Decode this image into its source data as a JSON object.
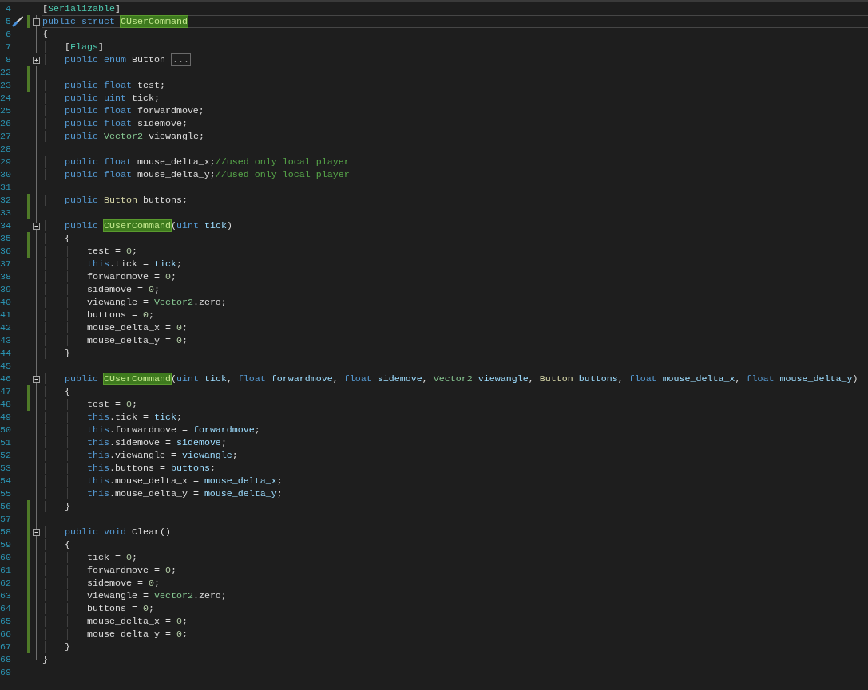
{
  "lines": [
    {
      "number": "4",
      "changed": false,
      "kind": "outer",
      "action": false,
      "current": false,
      "tokens": [
        {
          "kind": "plain",
          "text": "["
        },
        {
          "kind": "type",
          "text": "Serializable"
        },
        {
          "kind": "plain",
          "text": "]"
        }
      ]
    },
    {
      "number": "5",
      "changed": true,
      "kind": "open",
      "action": true,
      "current": true,
      "tokens": [
        {
          "kind": "keyword",
          "text": "public struct "
        },
        {
          "kind": "match",
          "text": "CUserCommand"
        }
      ]
    },
    {
      "number": "6",
      "changed": false,
      "kind": "body",
      "action": false,
      "current": false,
      "tokens": [
        {
          "kind": "plain",
          "text": "{"
        }
      ]
    },
    {
      "number": "7",
      "changed": false,
      "kind": "body",
      "action": false,
      "current": false,
      "tokens": [
        {
          "kind": "plain",
          "text": "    ["
        },
        {
          "kind": "type",
          "text": "Flags"
        },
        {
          "kind": "plain",
          "text": "]"
        }
      ]
    },
    {
      "number": "8",
      "changed": false,
      "kind": "closed",
      "action": false,
      "current": false,
      "tokens": [
        {
          "kind": "keyword",
          "text": "    public enum "
        },
        {
          "kind": "plain",
          "text": "Button "
        },
        {
          "kind": "collapsed",
          "text": "..."
        }
      ]
    },
    {
      "number": "22",
      "changed": true,
      "kind": "body",
      "action": false,
      "current": false
    },
    {
      "number": "23",
      "changed": true,
      "kind": "body",
      "action": false,
      "current": false,
      "tokens": [
        {
          "kind": "keyword",
          "text": "    public float "
        },
        {
          "kind": "plain",
          "text": "test;"
        }
      ]
    },
    {
      "number": "24",
      "changed": false,
      "kind": "body",
      "action": false,
      "current": false,
      "tokens": [
        {
          "kind": "keyword",
          "text": "    public uint "
        },
        {
          "kind": "plain",
          "text": "tick;"
        }
      ]
    },
    {
      "number": "25",
      "changed": false,
      "kind": "body",
      "action": false,
      "current": false,
      "tokens": [
        {
          "kind": "keyword",
          "text": "    public float "
        },
        {
          "kind": "plain",
          "text": "forwardmove;"
        }
      ]
    },
    {
      "number": "26",
      "changed": false,
      "kind": "body",
      "action": false,
      "current": false,
      "tokens": [
        {
          "kind": "keyword",
          "text": "    public float "
        },
        {
          "kind": "plain",
          "text": "sidemove;"
        }
      ]
    },
    {
      "number": "27",
      "changed": false,
      "kind": "body",
      "action": false,
      "current": false,
      "tokens": [
        {
          "kind": "keyword",
          "text": "    public "
        },
        {
          "kind": "struct",
          "text": "Vector2 "
        },
        {
          "kind": "plain",
          "text": "viewangle;"
        }
      ]
    },
    {
      "number": "28",
      "changed": false,
      "kind": "body",
      "action": false,
      "current": false
    },
    {
      "number": "29",
      "changed": false,
      "kind": "body",
      "action": false,
      "current": false,
      "tokens": [
        {
          "kind": "keyword",
          "text": "    public float "
        },
        {
          "kind": "plain",
          "text": "mouse_delta_x;"
        },
        {
          "kind": "comment",
          "text": "//used only local player"
        }
      ]
    },
    {
      "number": "30",
      "changed": false,
      "kind": "body",
      "action": false,
      "current": false,
      "tokens": [
        {
          "kind": "keyword",
          "text": "    public float "
        },
        {
          "kind": "plain",
          "text": "mouse_delta_y;"
        },
        {
          "kind": "comment",
          "text": "//used only local player"
        }
      ]
    },
    {
      "number": "31",
      "changed": false,
      "kind": "body",
      "action": false,
      "current": false
    },
    {
      "number": "32",
      "changed": true,
      "kind": "body",
      "action": false,
      "current": false,
      "tokens": [
        {
          "kind": "keyword",
          "text": "    public "
        },
        {
          "kind": "enum",
          "text": "Button "
        },
        {
          "kind": "plain",
          "text": "buttons;"
        }
      ]
    },
    {
      "number": "33",
      "changed": true,
      "kind": "body",
      "action": false,
      "current": false
    },
    {
      "number": "34",
      "changed": false,
      "kind": "open",
      "action": false,
      "current": false,
      "tokens": [
        {
          "kind": "keyword",
          "text": "    public "
        },
        {
          "kind": "match",
          "text": "CUserCommand"
        },
        {
          "kind": "plain",
          "text": "("
        },
        {
          "kind": "keyword",
          "text": "uint "
        },
        {
          "kind": "param",
          "text": "tick"
        },
        {
          "kind": "plain",
          "text": ")"
        }
      ]
    },
    {
      "number": "35",
      "changed": true,
      "kind": "body",
      "action": false,
      "current": false,
      "tokens": [
        {
          "kind": "plain",
          "text": "    {"
        }
      ]
    },
    {
      "number": "36",
      "changed": true,
      "kind": "body",
      "action": false,
      "current": false,
      "tokens": [
        {
          "kind": "plain",
          "text": "        test = "
        },
        {
          "kind": "number",
          "text": "0"
        },
        {
          "kind": "plain",
          "text": ";"
        }
      ]
    },
    {
      "number": "37",
      "changed": false,
      "kind": "body",
      "action": false,
      "current": false,
      "tokens": [
        {
          "kind": "keyword",
          "text": "        this"
        },
        {
          "kind": "plain",
          "text": ".tick = "
        },
        {
          "kind": "param",
          "text": "tick"
        },
        {
          "kind": "plain",
          "text": ";"
        }
      ]
    },
    {
      "number": "38",
      "changed": false,
      "kind": "body",
      "action": false,
      "current": false,
      "tokens": [
        {
          "kind": "plain",
          "text": "        forwardmove = "
        },
        {
          "kind": "number",
          "text": "0"
        },
        {
          "kind": "plain",
          "text": ";"
        }
      ]
    },
    {
      "number": "39",
      "changed": false,
      "kind": "body",
      "action": false,
      "current": false,
      "tokens": [
        {
          "kind": "plain",
          "text": "        sidemove = "
        },
        {
          "kind": "number",
          "text": "0"
        },
        {
          "kind": "plain",
          "text": ";"
        }
      ]
    },
    {
      "number": "40",
      "changed": false,
      "kind": "body",
      "action": false,
      "current": false,
      "tokens": [
        {
          "kind": "plain",
          "text": "        viewangle = "
        },
        {
          "kind": "struct",
          "text": "Vector2"
        },
        {
          "kind": "plain",
          "text": ".zero;"
        }
      ]
    },
    {
      "number": "41",
      "changed": false,
      "kind": "body",
      "action": false,
      "current": false,
      "tokens": [
        {
          "kind": "plain",
          "text": "        buttons = "
        },
        {
          "kind": "number",
          "text": "0"
        },
        {
          "kind": "plain",
          "text": ";"
        }
      ]
    },
    {
      "number": "42",
      "changed": false,
      "kind": "body",
      "action": false,
      "current": false,
      "tokens": [
        {
          "kind": "plain",
          "text": "        mouse_delta_x = "
        },
        {
          "kind": "number",
          "text": "0"
        },
        {
          "kind": "plain",
          "text": ";"
        }
      ]
    },
    {
      "number": "43",
      "changed": false,
      "kind": "body",
      "action": false,
      "current": false,
      "tokens": [
        {
          "kind": "plain",
          "text": "        mouse_delta_y = "
        },
        {
          "kind": "number",
          "text": "0"
        },
        {
          "kind": "plain",
          "text": ";"
        }
      ]
    },
    {
      "number": "44",
      "changed": false,
      "kind": "body",
      "action": false,
      "current": false,
      "tokens": [
        {
          "kind": "plain",
          "text": "    }"
        }
      ]
    },
    {
      "number": "45",
      "changed": false,
      "kind": "body",
      "action": false,
      "current": false
    },
    {
      "number": "46",
      "changed": false,
      "kind": "open",
      "action": false,
      "current": false,
      "tokens": [
        {
          "kind": "keyword",
          "text": "    public "
        },
        {
          "kind": "match",
          "text": "CUserCommand"
        },
        {
          "kind": "plain",
          "text": "("
        },
        {
          "kind": "keyword",
          "text": "uint "
        },
        {
          "kind": "param",
          "text": "tick"
        },
        {
          "kind": "plain",
          "text": ", "
        },
        {
          "kind": "keyword",
          "text": "float "
        },
        {
          "kind": "param",
          "text": "forwardmove"
        },
        {
          "kind": "plain",
          "text": ", "
        },
        {
          "kind": "keyword",
          "text": "float "
        },
        {
          "kind": "param",
          "text": "sidemove"
        },
        {
          "kind": "plain",
          "text": ", "
        },
        {
          "kind": "struct",
          "text": "Vector2 "
        },
        {
          "kind": "param",
          "text": "viewangle"
        },
        {
          "kind": "plain",
          "text": ", "
        },
        {
          "kind": "enum",
          "text": "Button "
        },
        {
          "kind": "param",
          "text": "buttons"
        },
        {
          "kind": "plain",
          "text": ", "
        },
        {
          "kind": "keyword",
          "text": "float "
        },
        {
          "kind": "param",
          "text": "mouse_delta_x"
        },
        {
          "kind": "plain",
          "text": ", "
        },
        {
          "kind": "keyword",
          "text": "float "
        },
        {
          "kind": "param",
          "text": "mouse_delta_y"
        },
        {
          "kind": "plain",
          "text": ")"
        }
      ]
    },
    {
      "number": "47",
      "changed": true,
      "kind": "body",
      "action": false,
      "current": false,
      "tokens": [
        {
          "kind": "plain",
          "text": "    {"
        }
      ]
    },
    {
      "number": "48",
      "changed": true,
      "kind": "body",
      "action": false,
      "current": false,
      "tokens": [
        {
          "kind": "plain",
          "text": "        test = "
        },
        {
          "kind": "number",
          "text": "0"
        },
        {
          "kind": "plain",
          "text": ";"
        }
      ]
    },
    {
      "number": "49",
      "changed": false,
      "kind": "body",
      "action": false,
      "current": false,
      "tokens": [
        {
          "kind": "keyword",
          "text": "        this"
        },
        {
          "kind": "plain",
          "text": ".tick = "
        },
        {
          "kind": "param",
          "text": "tick"
        },
        {
          "kind": "plain",
          "text": ";"
        }
      ]
    },
    {
      "number": "50",
      "changed": false,
      "kind": "body",
      "action": false,
      "current": false,
      "tokens": [
        {
          "kind": "keyword",
          "text": "        this"
        },
        {
          "kind": "plain",
          "text": ".forwardmove = "
        },
        {
          "kind": "param",
          "text": "forwardmove"
        },
        {
          "kind": "plain",
          "text": ";"
        }
      ]
    },
    {
      "number": "51",
      "changed": false,
      "kind": "body",
      "action": false,
      "current": false,
      "tokens": [
        {
          "kind": "keyword",
          "text": "        this"
        },
        {
          "kind": "plain",
          "text": ".sidemove = "
        },
        {
          "kind": "param",
          "text": "sidemove"
        },
        {
          "kind": "plain",
          "text": ";"
        }
      ]
    },
    {
      "number": "52",
      "changed": false,
      "kind": "body",
      "action": false,
      "current": false,
      "tokens": [
        {
          "kind": "keyword",
          "text": "        this"
        },
        {
          "kind": "plain",
          "text": ".viewangle = "
        },
        {
          "kind": "param",
          "text": "viewangle"
        },
        {
          "kind": "plain",
          "text": ";"
        }
      ]
    },
    {
      "number": "53",
      "changed": false,
      "kind": "body",
      "action": false,
      "current": false,
      "tokens": [
        {
          "kind": "keyword",
          "text": "        this"
        },
        {
          "kind": "plain",
          "text": ".buttons = "
        },
        {
          "kind": "param",
          "text": "buttons"
        },
        {
          "kind": "plain",
          "text": ";"
        }
      ]
    },
    {
      "number": "54",
      "changed": false,
      "kind": "body",
      "action": false,
      "current": false,
      "tokens": [
        {
          "kind": "keyword",
          "text": "        this"
        },
        {
          "kind": "plain",
          "text": ".mouse_delta_x = "
        },
        {
          "kind": "param",
          "text": "mouse_delta_x"
        },
        {
          "kind": "plain",
          "text": ";"
        }
      ]
    },
    {
      "number": "55",
      "changed": false,
      "kind": "body",
      "action": false,
      "current": false,
      "tokens": [
        {
          "kind": "keyword",
          "text": "        this"
        },
        {
          "kind": "plain",
          "text": ".mouse_delta_y = "
        },
        {
          "kind": "param",
          "text": "mouse_delta_y"
        },
        {
          "kind": "plain",
          "text": ";"
        }
      ]
    },
    {
      "number": "56",
      "changed": true,
      "kind": "body",
      "action": false,
      "current": false,
      "tokens": [
        {
          "kind": "plain",
          "text": "    }"
        }
      ]
    },
    {
      "number": "57",
      "changed": true,
      "kind": "body",
      "action": false,
      "current": false
    },
    {
      "number": "58",
      "changed": true,
      "kind": "open",
      "action": false,
      "current": false,
      "tokens": [
        {
          "kind": "keyword",
          "text": "    public void "
        },
        {
          "kind": "plain",
          "text": "Clear()"
        }
      ]
    },
    {
      "number": "59",
      "changed": true,
      "kind": "body",
      "action": false,
      "current": false,
      "tokens": [
        {
          "kind": "plain",
          "text": "    {"
        }
      ]
    },
    {
      "number": "60",
      "changed": true,
      "kind": "body",
      "action": false,
      "current": false,
      "tokens": [
        {
          "kind": "plain",
          "text": "        tick = "
        },
        {
          "kind": "number",
          "text": "0"
        },
        {
          "kind": "plain",
          "text": ";"
        }
      ]
    },
    {
      "number": "61",
      "changed": true,
      "kind": "body",
      "action": false,
      "current": false,
      "tokens": [
        {
          "kind": "plain",
          "text": "        forwardmove = "
        },
        {
          "kind": "number",
          "text": "0"
        },
        {
          "kind": "plain",
          "text": ";"
        }
      ]
    },
    {
      "number": "62",
      "changed": true,
      "kind": "body",
      "action": false,
      "current": false,
      "tokens": [
        {
          "kind": "plain",
          "text": "        sidemove = "
        },
        {
          "kind": "number",
          "text": "0"
        },
        {
          "kind": "plain",
          "text": ";"
        }
      ]
    },
    {
      "number": "63",
      "changed": true,
      "kind": "body",
      "action": false,
      "current": false,
      "tokens": [
        {
          "kind": "plain",
          "text": "        viewangle = "
        },
        {
          "kind": "struct",
          "text": "Vector2"
        },
        {
          "kind": "plain",
          "text": ".zero;"
        }
      ]
    },
    {
      "number": "64",
      "changed": true,
      "kind": "body",
      "action": false,
      "current": false,
      "tokens": [
        {
          "kind": "plain",
          "text": "        buttons = "
        },
        {
          "kind": "number",
          "text": "0"
        },
        {
          "kind": "plain",
          "text": ";"
        }
      ]
    },
    {
      "number": "65",
      "changed": true,
      "kind": "body",
      "action": false,
      "current": false,
      "tokens": [
        {
          "kind": "plain",
          "text": "        mouse_delta_x = "
        },
        {
          "kind": "number",
          "text": "0"
        },
        {
          "kind": "plain",
          "text": ";"
        }
      ]
    },
    {
      "number": "66",
      "changed": true,
      "kind": "body",
      "action": false,
      "current": false,
      "tokens": [
        {
          "kind": "plain",
          "text": "        mouse_delta_y = "
        },
        {
          "kind": "number",
          "text": "0"
        },
        {
          "kind": "plain",
          "text": ";"
        }
      ]
    },
    {
      "number": "67",
      "changed": true,
      "kind": "body",
      "action": false,
      "current": false,
      "tokens": [
        {
          "kind": "plain",
          "text": "    }"
        }
      ]
    },
    {
      "number": "68",
      "changed": false,
      "kind": "end",
      "action": false,
      "current": false,
      "tokens": [
        {
          "kind": "plain",
          "text": "}"
        }
      ]
    },
    {
      "number": "69",
      "changed": false,
      "kind": "outer",
      "action": false,
      "current": false
    }
  ]
}
